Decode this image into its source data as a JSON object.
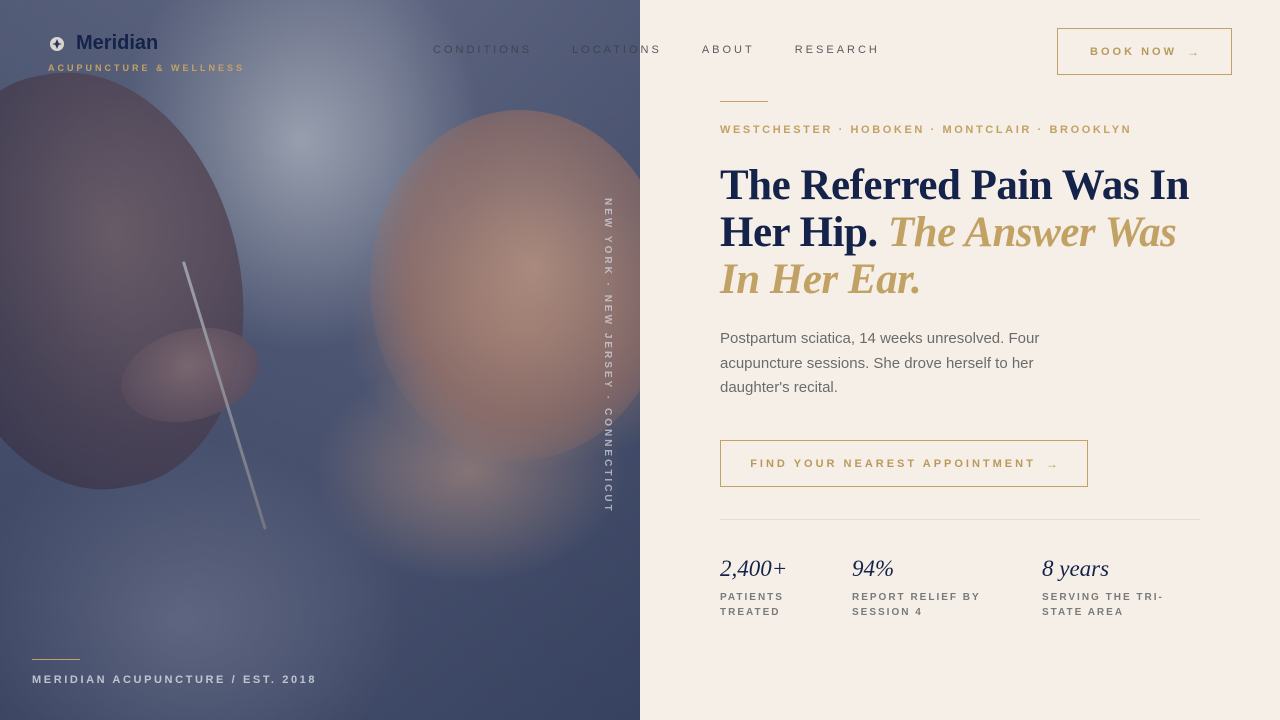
{
  "brand": {
    "name": "Meridian",
    "tagline": "ACUPUNCTURE & WELLNESS"
  },
  "nav": {
    "items": [
      "CONDITIONS",
      "LOCATIONS",
      "ABOUT",
      "RESEARCH"
    ],
    "book_label": "BOOK NOW"
  },
  "photo": {
    "vertical_text": "NEW YORK · NEW JERSEY · CONNECTICUT",
    "footer": "MERIDIAN ACUPUNCTURE / EST. 2018"
  },
  "hero": {
    "locations": "WESTCHESTER · HOBOKEN · MONTCLAIR · BROOKLYN",
    "headline_plain": "The Referred Pain Was In Her Hip.",
    "headline_accent": "The Answer Was In Her Ear.",
    "body": "Postpartum sciatica, 14 weeks unresolved. Four acupuncture sessions. She drove herself to her daughter's recital.",
    "cta_label": "FIND YOUR NEAREST APPOINTMENT"
  },
  "stats": [
    {
      "value": "2,400+",
      "label": "PATIENTS TREATED"
    },
    {
      "value": "94%",
      "label": "REPORT RELIEF BY SESSION 4"
    },
    {
      "value": "8 years",
      "label": "SERVING THE TRI-STATE AREA"
    }
  ],
  "colors": {
    "navy": "#15234a",
    "gold": "#c2a264",
    "cream": "#f5efe7"
  },
  "icons": {
    "logo": "lotus-icon",
    "arrow": "arrow-right-icon"
  }
}
